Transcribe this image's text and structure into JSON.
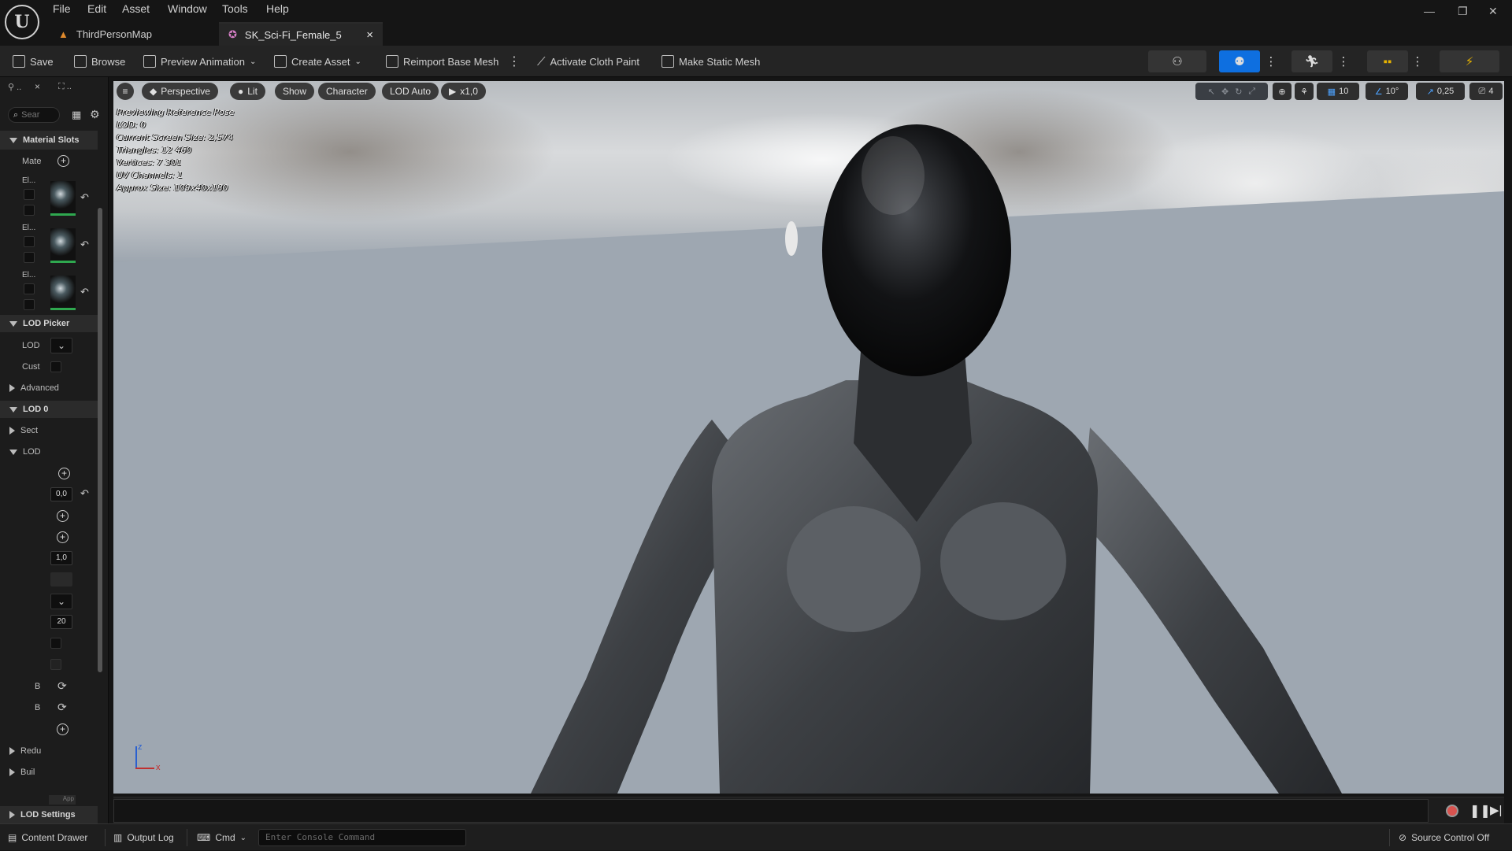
{
  "menu": [
    "File",
    "Edit",
    "Asset",
    "Window",
    "Tools",
    "Help"
  ],
  "window_controls": {
    "minimize": "—",
    "restore": "❐",
    "close": "✕"
  },
  "tabs": [
    {
      "label": "ThirdPersonMap"
    },
    {
      "label": "SK_Sci-Fi_Female_5",
      "close": "×"
    }
  ],
  "toolbar": {
    "save": "Save",
    "browse": "Browse",
    "preview_animation": "Preview Animation",
    "create_asset": "Create Asset",
    "reimport": "Reimport Base Mesh",
    "cloth_paint": "Activate Cloth Paint",
    "static_mesh": "Make Static Mesh"
  },
  "left_panel": {
    "tab1_label": "..",
    "tab2_label": "..",
    "close": "×",
    "search_placeholder": "Sear",
    "material_slots": "Material Slots",
    "mate": "Mate",
    "el1": "El...",
    "el2": "El...",
    "el3": "El...",
    "lod_picker": "LOD Picker",
    "lod": "LOD",
    "cust": "Cust",
    "advanced": "Advanced",
    "lod0": "LOD 0",
    "sect": "Sect",
    "lod_sub": "LOD",
    "val1": "0,0",
    "val2": "1,0",
    "val3": "20",
    "b1": "B",
    "b2": "B",
    "redu": "Redu",
    "buil": "Buil",
    "apply": "App",
    "lod_settings": "LOD Settings"
  },
  "viewport": {
    "perspective": "Perspective",
    "lit": "Lit",
    "show": "Show",
    "character": "Character",
    "lod_auto": "LOD Auto",
    "speed": "x1,0",
    "grid_snap": "10",
    "rot_snap": "10°",
    "scale_snap": "0,25",
    "cam_speed": "4",
    "stats": [
      "Previewing Reference Pose",
      "LOD: 0",
      "Current Screen Size: 2,574",
      "Triangles: 12 460",
      "Vertices: 7 301",
      "UV Channels: 1",
      "Approx Size: 109x40x180"
    ],
    "axis_z": "z",
    "axis_x": "x"
  },
  "statusbar": {
    "content_drawer": "Content Drawer",
    "output_log": "Output Log",
    "cmd": "Cmd",
    "console_placeholder": "Enter Console Command",
    "source_control": "Source Control Off"
  },
  "colors": {
    "accent": "#0e6fe0",
    "green": "#2fa84f",
    "record": "#d9534f"
  }
}
